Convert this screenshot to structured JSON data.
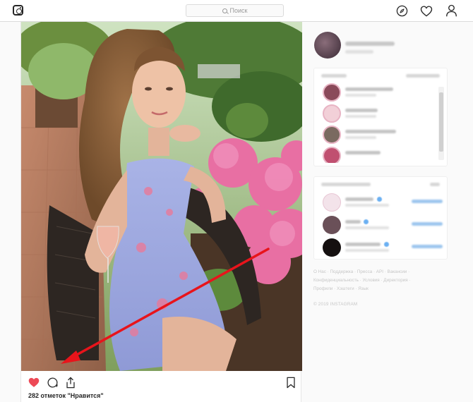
{
  "header": {
    "logo_icon": "instagram-camera-icon",
    "search_placeholder": "Поиск",
    "search_icon": "search-icon",
    "nav_icons": [
      "compass-icon",
      "heart-outline-icon",
      "profile-icon"
    ]
  },
  "post": {
    "image_description_icon": "photo",
    "liked": true,
    "likes_text": "282 отметок \"Нравится\"",
    "actions": [
      "heart-filled-icon",
      "comment-icon",
      "share-icon",
      "bookmark-icon"
    ],
    "annotation_arrow_color": "#e8141b",
    "like_color": "#ed4956"
  },
  "sidebar": {
    "stories_count": 4,
    "suggestions_count": 3
  },
  "footer": {
    "links_line1": "О Нас · Поддержка · Пресса · API · Вакансии ·",
    "links_line2": "Конфиденциальность · Условия · Директория ·",
    "links_line3": "Профили · Хэштеги · Язык",
    "copyright": "© 2019 INSTAGRAM"
  }
}
